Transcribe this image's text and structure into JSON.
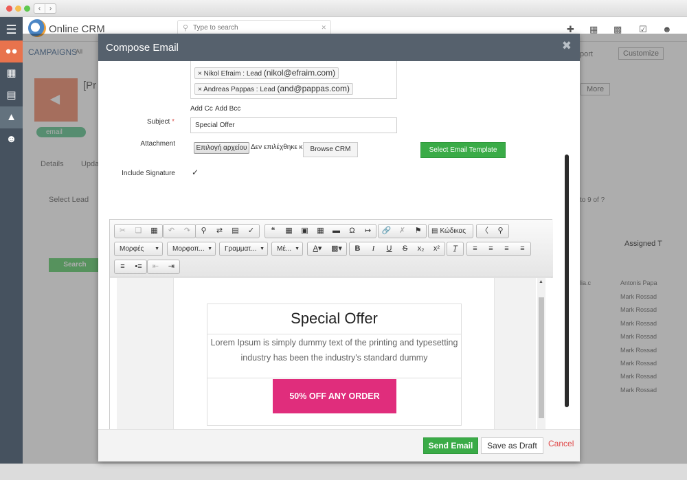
{
  "app": {
    "name": "Online CRM"
  },
  "window": {
    "colors": {
      "close": "#ee5c56",
      "minimize": "#f5bd4f",
      "maximize": "#5ec84e"
    }
  },
  "topbar": {
    "search_placeholder": "Type to search"
  },
  "background": {
    "breadcrumb": "CAMPAIGNS",
    "breadcrumb_all": "All",
    "record_title": "[Pr",
    "tag": "email",
    "tabs": [
      "Details",
      "Upda"
    ],
    "select_lead": "Select Lead",
    "search_button": "Search",
    "more": "More",
    "report": "port",
    "customize": "Customize",
    "pager": "to 9 of ?",
    "column": "Assigned T",
    "assigned": [
      "Antonis Papa",
      "Mark Rossad",
      "Mark Rossad",
      "Mark Rossad",
      "Mark Rossad",
      "Mark Rossad",
      "Mark Rossad",
      "Mark Rossad",
      "Mark Rossad"
    ],
    "email_fragment": "lia.c"
  },
  "modal": {
    "title": "Compose Email",
    "recipients": [
      {
        "prefix": "Nikol Efraim : Lead",
        "email": "(nikol@efraim.com)"
      },
      {
        "prefix": "Andreas Pappas : Lead",
        "email": "(and@pappas.com)"
      }
    ],
    "add_cc": "Add Cc",
    "add_bcc": "Add Bcc",
    "subject_label": "Subject",
    "required_mark": "*",
    "subject_value": "Special Offer",
    "attachment_label": "Attachment",
    "choose_file": "Επιλογή αρχείου",
    "no_file": "Δεν επιλέχθηκε κ",
    "browse_crm": "Browse CRM",
    "select_template": "Select Email Template",
    "include_signature_label": "Include Signature",
    "include_signature_checked": true,
    "toolbar": {
      "format": "Μορφές",
      "format2": "Μορφοπ...",
      "font": "Γραμματ...",
      "size": "Μέ...",
      "source": "Κώδικας"
    },
    "template": {
      "heading": "Special Offer",
      "body": "Lorem Ipsum is simply dummy text of the printing and typesetting industry has been the industry's standard dummy",
      "cta": "50% OFF ANY ORDER",
      "cta_color": "#e02d7c"
    },
    "footer": {
      "send": "Send Email",
      "draft": "Save as Draft",
      "cancel": "Cancel"
    }
  }
}
